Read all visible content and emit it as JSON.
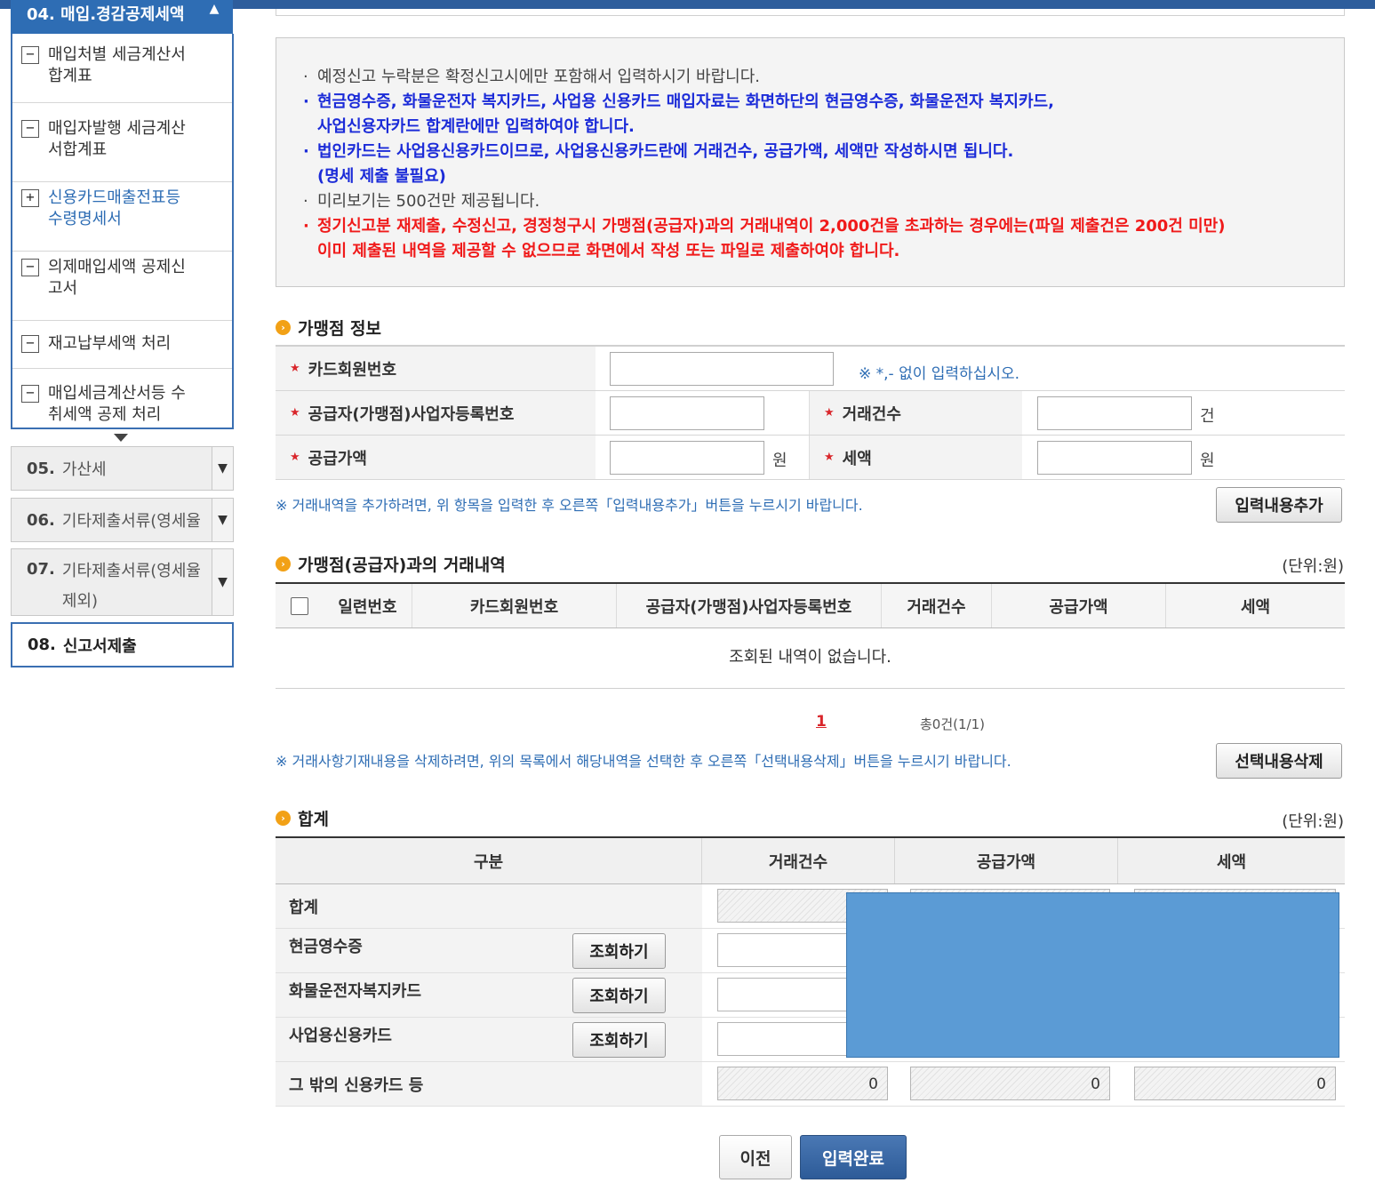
{
  "sidebar": {
    "header": "04. 매입.경감공제세액",
    "items": [
      {
        "icon": "−",
        "label1": "매입처별 세금계산서",
        "label2": "합계표"
      },
      {
        "icon": "−",
        "label1": "매입자발행 세금계산",
        "label2": "서합계표"
      },
      {
        "icon": "+",
        "label1": "신용카드매출전표등",
        "label2": "수령명세서"
      },
      {
        "icon": "−",
        "label1": "의제매입세액 공제신",
        "label2": "고서"
      },
      {
        "icon": "−",
        "label1": "재고납부세액 처리",
        "label2": ""
      },
      {
        "icon": "−",
        "label1": "매입세금계산서등 수",
        "label2": "취세액 공제 처리"
      }
    ],
    "steps": [
      {
        "num": "05.",
        "label": "가산세",
        "label2": ""
      },
      {
        "num": "06.",
        "label": "기타제출서류(영세율",
        "label2": ""
      },
      {
        "num": "07.",
        "label": "기타제출서류(영세율",
        "label2": "제외)"
      },
      {
        "num": "08.",
        "label": "신고서제출",
        "label2": ""
      }
    ]
  },
  "notice": [
    "예정신고 누락분은 확정신고시에만 포함해서 입력하시기 바랍니다.",
    "현금영수증, 화물운전자 복지카드, 사업용 신용카드 매입자료는 화면하단의 현금영수증, 화물운전자 복지카드,",
    "사업신용자카드 합계란에만 입력하여야 합니다.",
    "법인카드는 사업용신용카드이므로, 사업용신용카드란에 거래건수, 공급가액, 세액만 작성하시면 됩니다.",
    "(명세 제출 불필요)",
    "미리보기는 500건만 제공됩니다.",
    "정기신고분 재제출, 수정신고, 경정청구시 가맹점(공급자)과의 거래내역이 2,000건을 초과하는 경우에는(파일 제출건은 200건 미만)",
    "이미 제출된 내역을 제공할 수 없으므로 화면에서 작성 또는 파일로 제출하여야 합니다."
  ],
  "merchant": {
    "title": "가맹점 정보",
    "card_no_label": "카드회원번호",
    "card_no_hint": "※ *,- 없이 입력하십시오.",
    "biz_no_label": "공급자(가맹점)사업자등록번호",
    "count_label": "거래건수",
    "count_unit": "건",
    "supply_label": "공급가액",
    "supply_unit": "원",
    "tax_label": "세액",
    "tax_unit": "원",
    "add_hint": "※ 거래내역을 추가하려면, 위 항목을 입력한 후 오른쪽「입력내용추가」버튼을 누르시기 바랍니다.",
    "add_button": "입력내용추가"
  },
  "history": {
    "title": "가맹점(공급자)과의 거래내역",
    "unit": "(단위:원)",
    "columns": [
      "일련번호",
      "카드회원번호",
      "공급자(가맹점)사업자등록번호",
      "거래건수",
      "공급가액",
      "세액"
    ],
    "empty": "조회된 내역이 없습니다.",
    "page": "1",
    "total": "총0건(1/1)",
    "delete_hint": "※ 거래사항기재내용을 삭제하려면, 위의 목록에서 해당내역을 선택한 후 오른쪽「선택내용삭제」버튼을 누르시기 바랍니다.",
    "delete_button": "선택내용삭제"
  },
  "summary": {
    "title": "합계",
    "unit": "(단위:원)",
    "columns": [
      "구분",
      "거래건수",
      "공급가액",
      "세액"
    ],
    "rows": [
      {
        "label": "합계",
        "button": "",
        "values": [
          "",
          "",
          ""
        ]
      },
      {
        "label": "현금영수증",
        "button": "조회하기",
        "values": [
          "",
          "",
          ""
        ]
      },
      {
        "label": "화물운전자복지카드",
        "button": "조회하기",
        "values": [
          "",
          "",
          ""
        ]
      },
      {
        "label": "사업용신용카드",
        "button": "조회하기",
        "values": [
          "",
          "",
          ""
        ]
      },
      {
        "label": "그 밖의 신용카드 등",
        "button": "",
        "values": [
          "0",
          "0",
          "0"
        ]
      }
    ]
  },
  "footer": {
    "prev": "이전",
    "done": "입력완료"
  },
  "colors": {
    "accent": "#2e6db4",
    "notice_blue": "#1b2bd8",
    "notice_red": "#f01a1a",
    "mask": "#5b9bd5"
  }
}
